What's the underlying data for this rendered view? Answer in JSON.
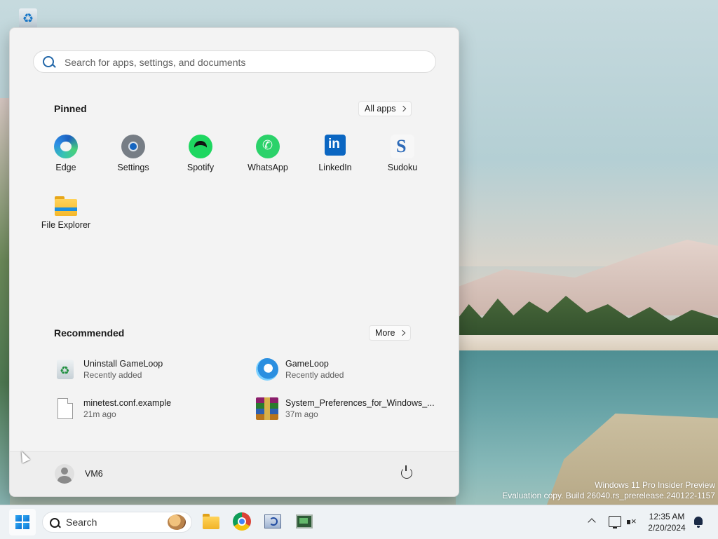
{
  "desktop": {
    "watermark_line1": "Windows 11 Pro Insider Preview",
    "watermark_line2": "Evaluation copy. Build 26040.rs_prerelease.240122-1157"
  },
  "start_menu": {
    "search_placeholder": "Search for apps, settings, and documents",
    "pinned_title": "Pinned",
    "all_apps_label": "All apps",
    "pinned": [
      {
        "label": "Edge",
        "icon": "edge-icon"
      },
      {
        "label": "Settings",
        "icon": "settings-gear-icon"
      },
      {
        "label": "Spotify",
        "icon": "spotify-icon"
      },
      {
        "label": "WhatsApp",
        "icon": "whatsapp-icon"
      },
      {
        "label": "LinkedIn",
        "icon": "linkedin-icon"
      },
      {
        "label": "Sudoku",
        "icon": "sudoku-icon"
      },
      {
        "label": "File Explorer",
        "icon": "folder-icon"
      }
    ],
    "recommended_title": "Recommended",
    "more_label": "More",
    "recommended": [
      {
        "title": "Uninstall GameLoop",
        "subtitle": "Recently added",
        "icon": "recycle-bin-icon"
      },
      {
        "title": "GameLoop",
        "subtitle": "Recently added",
        "icon": "gameloop-icon"
      },
      {
        "title": "minetest.conf.example",
        "subtitle": "21m ago",
        "icon": "file-icon"
      },
      {
        "title": "System_Preferences_for_Windows_...",
        "subtitle": "37m ago",
        "icon": "winrar-archive-icon"
      }
    ],
    "user_name": "VM6"
  },
  "taskbar": {
    "search_label": "Search",
    "clock_time": "12:35 AM",
    "clock_date": "2/20/2024"
  }
}
